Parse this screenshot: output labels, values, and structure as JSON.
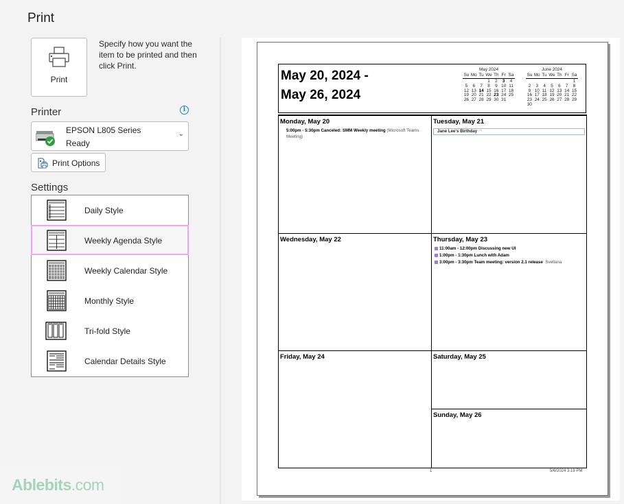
{
  "header": {
    "title": "Print"
  },
  "print_button": {
    "label": "Print",
    "icon": "printer-icon"
  },
  "description": "Specify how you want the item to be printed and then click Print.",
  "printer": {
    "section_label": "Printer",
    "info_icon": "i",
    "name": "EPSON L805 Series",
    "status": "Ready",
    "status_icon": "check-circle-icon",
    "chevron": "⌄"
  },
  "print_options": {
    "label": "Print Options",
    "icon": "print-options-icon"
  },
  "settings": {
    "section_label": "Settings",
    "selected": "Weekly Agenda Style",
    "styles": [
      {
        "label": "Daily Style",
        "icon": "daily-style-icon"
      },
      {
        "label": "Weekly Agenda Style",
        "icon": "weekly-agenda-style-icon"
      },
      {
        "label": "Weekly Calendar Style",
        "icon": "weekly-calendar-style-icon"
      },
      {
        "label": "Monthly Style",
        "icon": "monthly-style-icon"
      },
      {
        "label": "Tri-fold Style",
        "icon": "tri-fold-style-icon"
      },
      {
        "label": "Calendar Details Style",
        "icon": "calendar-details-style-icon"
      }
    ]
  },
  "watermark": {
    "brand": "Ablebits",
    "suffix": ".com",
    "color": "#a7d3bd"
  },
  "preview": {
    "range_line1": "May 20, 2024 -",
    "range_line2": "May 26, 2024",
    "mini_calendars": [
      {
        "title": "May 2024",
        "weekdays": [
          "Su",
          "Mo",
          "Tu",
          "We",
          "Th",
          "Fr",
          "Sa"
        ],
        "weeks": [
          [
            "",
            "",
            "",
            "1",
            "2",
            "3",
            "4"
          ],
          [
            "5",
            "6",
            "7",
            "8",
            "9",
            "10",
            "11"
          ],
          [
            "12",
            "13",
            "14",
            "15",
            "16",
            "17",
            "18"
          ],
          [
            "19",
            "20",
            "21",
            "22",
            "23",
            "24",
            "25"
          ],
          [
            "26",
            "27",
            "28",
            "29",
            "30",
            "31",
            ""
          ]
        ],
        "bold_days": [
          "3",
          "14",
          "23"
        ]
      },
      {
        "title": "June 2024",
        "weekdays": [
          "Su",
          "Mo",
          "Tu",
          "We",
          "Th",
          "Fr",
          "Sa"
        ],
        "weeks": [
          [
            "",
            "",
            "",
            "",
            "",
            "",
            "1"
          ],
          [
            "2",
            "3",
            "4",
            "5",
            "6",
            "7",
            "8"
          ],
          [
            "9",
            "10",
            "11",
            "12",
            "13",
            "14",
            "15"
          ],
          [
            "16",
            "17",
            "18",
            "19",
            "20",
            "21",
            "22"
          ],
          [
            "23",
            "24",
            "25",
            "26",
            "27",
            "28",
            "29"
          ],
          [
            "30",
            "",
            "",
            "",
            "",
            "",
            ""
          ]
        ],
        "bold_days": []
      }
    ],
    "days": {
      "mon": {
        "label": "Monday, May 20",
        "events": [
          {
            "time": "5:00pm - 5:30pm",
            "title": "Canceled: SMM Weekly meeting",
            "location": "(Microsoft Teams",
            "location2": "Meeting)"
          }
        ]
      },
      "tue": {
        "label": "Tuesday, May 21",
        "all_day": "Jane Lee's Birthday",
        "all_day_icon": "recurring-icon"
      },
      "wed": {
        "label": "Wednesday, May 22"
      },
      "thu": {
        "label": "Thursday, May 23",
        "events": [
          {
            "time": "11:00am - 12:00pm",
            "title": "Discussing new UI",
            "organizer": ""
          },
          {
            "time": "1:00pm - 1:30pm",
            "title": "Lunch with Adam",
            "organizer": ""
          },
          {
            "time": "3:00pm - 3:30pm",
            "title": "Team meeting: version 2.1 release",
            "organizer": "Svetlana"
          }
        ],
        "category_color": "#9b7fd3"
      },
      "fri": {
        "label": "Friday, May 24"
      },
      "sat": {
        "label": "Saturday, May 25"
      },
      "sun": {
        "label": "Sunday, May 26"
      }
    },
    "footer": {
      "page": "1",
      "timestamp": "5/6/2024 3:19 PM"
    }
  }
}
